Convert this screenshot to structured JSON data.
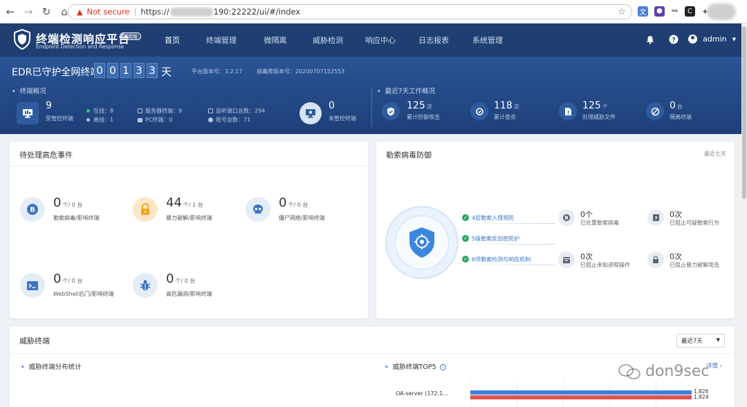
{
  "browser": {
    "security_label": "Not secure",
    "url_prefix": "https://",
    "url_suffix": "190:22222/ui/#/index"
  },
  "header": {
    "title": "终端检测响应平台",
    "badge": "试用版",
    "subtitle": "Endpoint Detection and Response",
    "nav": [
      {
        "label": "首页",
        "active": true
      },
      {
        "label": "终端管理"
      },
      {
        "label": "微隔离"
      },
      {
        "label": "威胁检测"
      },
      {
        "label": "响应中心"
      },
      {
        "label": "日志报表"
      },
      {
        "label": "系统管理"
      }
    ],
    "user": "admin"
  },
  "banner": {
    "title": "EDR已守护全网终端",
    "digits": [
      "0",
      "0",
      "1",
      "3",
      "3"
    ],
    "day_unit": "天",
    "platform_version": "平台版本号：3.2.17",
    "virus_db_version": "病毒库版本号：20200707152553",
    "endpoint_overview": {
      "heading": "终端概况",
      "managed_count": "9",
      "managed_label": "受管控终端",
      "online": "在线：8",
      "offline": "离线：1",
      "server": "服务器终端：9",
      "pc": "PC终端：0",
      "listen_ports": "监听端口总数：294",
      "accounts": "账号总数：71",
      "unmanaged_count": "0",
      "unmanaged_label": "未管控终端"
    },
    "weekly": {
      "heading": "最近7天工作概况",
      "items": [
        {
          "value": "125",
          "unit": "次",
          "label": "累计防御攻击"
        },
        {
          "value": "118",
          "unit": "次",
          "label": "累计查杀"
        },
        {
          "value": "125",
          "unit": "个",
          "label": "处理威胁文件"
        },
        {
          "value": "0",
          "unit": "台",
          "label": "隔离终端"
        }
      ]
    }
  },
  "pending": {
    "title": "待处理高危事件",
    "events": [
      {
        "value": "0",
        "unit": "个/ 0 台",
        "label": "勒索病毒/影响终端"
      },
      {
        "value": "44",
        "unit": "个/ 1 台",
        "label": "暴力破解/影响终端"
      },
      {
        "value": "0",
        "unit": "个/ 0 台",
        "label": "僵尸网络/影响终端"
      },
      {
        "value": "0",
        "unit": "个/ 0 台",
        "label": "WebShell后门/影响终端"
      },
      {
        "value": "0",
        "unit": "个/ 0 台",
        "label": "高危漏洞/影响终端"
      }
    ]
  },
  "ransomware": {
    "title": "勒索病毒防御",
    "range": "最近七天",
    "features": [
      "4层勒索入侵预防",
      "5级勒索反加密防护",
      "6项勒索检测与响应机制"
    ],
    "stats": [
      {
        "value": "0个",
        "label": "已处置勒索病毒"
      },
      {
        "value": "0次",
        "label": "已阻止可疑勒索行为"
      },
      {
        "value": "0次",
        "label": "已阻止未知进程操作"
      },
      {
        "value": "0次",
        "label": "已阻止暴力破解攻击"
      }
    ]
  },
  "threat": {
    "title": "威胁终端",
    "range_select": "最近7天",
    "dist_title": "威胁终端分布统计",
    "top5_title": "威胁终端TOP5",
    "detail_link": "详情 ›",
    "top5": [
      {
        "name": "OA-server (172.1...",
        "values": [
          1826,
          1824
        ],
        "labels": [
          "1,826",
          "1,824"
        ]
      }
    ],
    "colors": {
      "series_a": "#3a7ee0",
      "series_b": "#e2534f"
    }
  },
  "watermark": "don9sec"
}
